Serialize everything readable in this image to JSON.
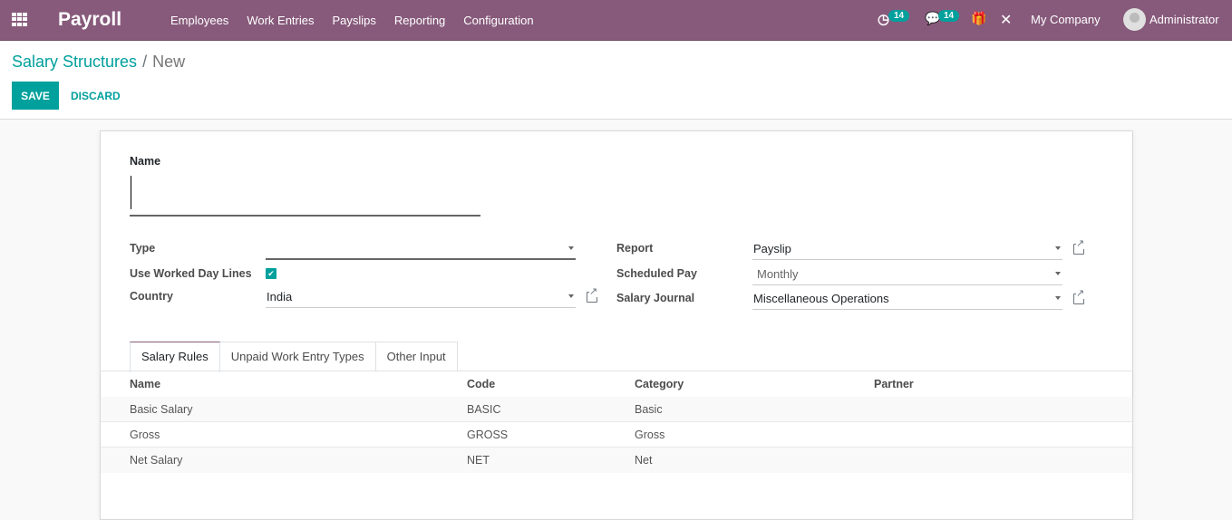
{
  "navbar": {
    "app_title": "Payroll",
    "menu": [
      "Employees",
      "Work Entries",
      "Payslips",
      "Reporting",
      "Configuration"
    ],
    "activity_badge": "14",
    "messages_badge": "14",
    "company": "My Company",
    "user": "Administrator"
  },
  "breadcrumb": {
    "parent": "Salary Structures",
    "separator": "/",
    "current": "New"
  },
  "buttons": {
    "save": "SAVE",
    "discard": "DISCARD"
  },
  "form": {
    "name_label": "Name",
    "name_value": "",
    "type_label": "Type",
    "type_value": "",
    "use_worked_day_lines_label": "Use Worked Day Lines",
    "use_worked_day_lines_checked": true,
    "country_label": "Country",
    "country_value": "India",
    "report_label": "Report",
    "report_value": "Payslip",
    "scheduled_pay_label": "Scheduled Pay",
    "scheduled_pay_value": "Monthly",
    "salary_journal_label": "Salary Journal",
    "salary_journal_value": "Miscellaneous Operations"
  },
  "tabs": [
    "Salary Rules",
    "Unpaid Work Entry Types",
    "Other Input"
  ],
  "table": {
    "columns": [
      "Name",
      "Code",
      "Category",
      "Partner"
    ],
    "rows": [
      [
        "Basic Salary",
        "BASIC",
        "Basic",
        ""
      ],
      [
        "Gross",
        "GROSS",
        "Gross",
        ""
      ],
      [
        "Net Salary",
        "NET",
        "Net",
        ""
      ]
    ]
  }
}
